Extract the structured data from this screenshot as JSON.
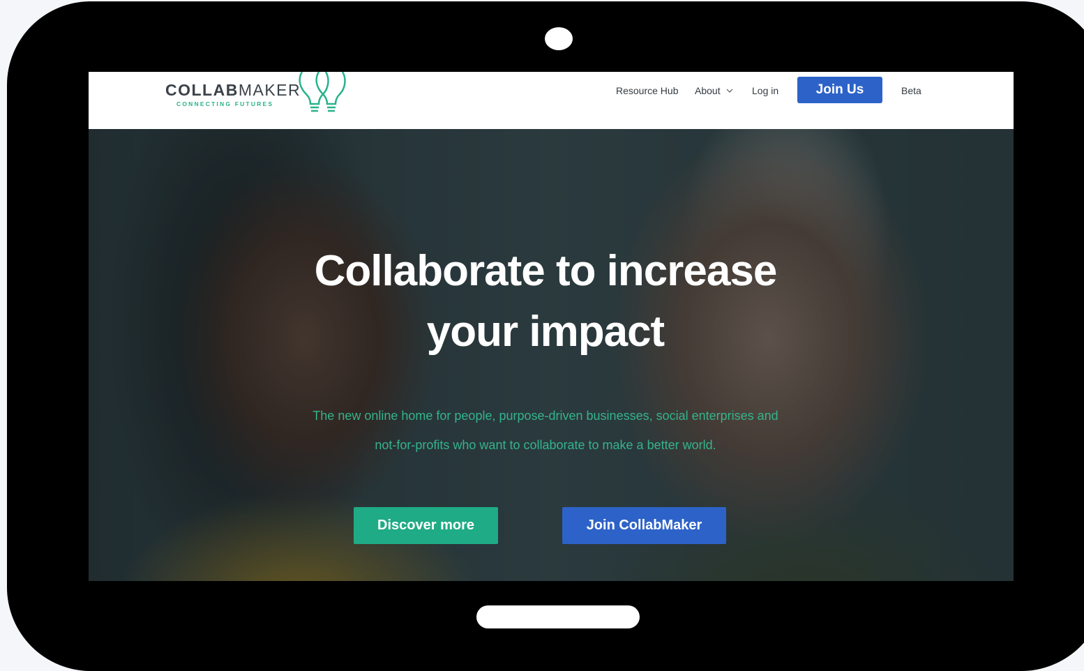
{
  "brand": {
    "name_bold": "COLLAB",
    "name_light": "MAKER",
    "tagline": "CONNECTING FUTURES"
  },
  "nav": {
    "items": [
      {
        "label": "Resource Hub"
      },
      {
        "label": "About"
      },
      {
        "label": "Log in"
      },
      {
        "label": "Join Us"
      },
      {
        "label": "Beta"
      }
    ]
  },
  "hero": {
    "title_line1": "Collaborate to increase",
    "title_line2": "your impact",
    "subtitle_line1": "The new online home for people, purpose-driven businesses, social enterprises and",
    "subtitle_line2": "not-for-profits who want to collaborate to make a better world.",
    "primary_button": "Discover more",
    "secondary_button": "Join CollabMaker"
  },
  "icons": {
    "logo": "double-lightbulb-logo-icon",
    "about_dropdown": "chevron-down-icon"
  },
  "colors": {
    "accent_green": "#1fab85",
    "accent_blue": "#2d63c8",
    "subtitle_green": "#35b38c",
    "device_frame": "#000000"
  }
}
